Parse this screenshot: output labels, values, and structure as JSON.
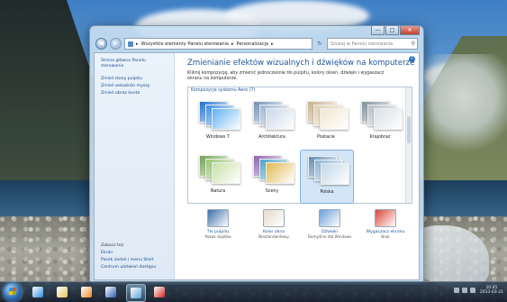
{
  "window": {
    "breadcrumb": [
      "Wszystkie elementy Panelu sterowania",
      "Personalizacja"
    ],
    "search_placeholder": "Szukaj w Panelu sterowania"
  },
  "sidebar": {
    "top_links": [
      "Strona główna Panelu sterowania",
      "Zmień ikony pulpitu",
      "Zmień wskaźniki myszy",
      "Zmień obraz konta"
    ],
    "see_also_heading": "Zobacz też",
    "bottom_links": [
      "Ekran",
      "Pasek zadań i menu Start",
      "Centrum ułatwień dostępu"
    ]
  },
  "main": {
    "title": "Zmienianie efektów wizualnych i dźwięków na komputerze",
    "subtitle": "Kliknij kompozycję, aby zmienić jednocześnie tło pulpitu, kolory okien, dźwięki i wygaszacz ekranu na komputerze.",
    "group_label": "Kompozycje systemu Aero (7)",
    "themes": [
      {
        "label": "Windows 7",
        "selected": false,
        "colors": [
          "#1e6fd0",
          "#3a8ee6",
          "#5fb1f2"
        ]
      },
      {
        "label": "Architektura",
        "selected": false,
        "colors": [
          "#6f8fb5",
          "#9bb6d3",
          "#c8d8e8"
        ]
      },
      {
        "label": "Postacie",
        "selected": false,
        "colors": [
          "#c9b28a",
          "#e0cfa9",
          "#f2e7d0"
        ]
      },
      {
        "label": "Krajobraz",
        "selected": false,
        "colors": [
          "#7f8f9a",
          "#b2bec6",
          "#d9dfe3"
        ]
      },
      {
        "label": "Natura",
        "selected": false,
        "colors": [
          "#6fa24d",
          "#98c46e",
          "#c6e1a4"
        ]
      },
      {
        "label": "Sceny",
        "selected": false,
        "colors": [
          "#8e5fb0",
          "#4aa3c8",
          "#e0b84f"
        ]
      },
      {
        "label": "Polska",
        "selected": true,
        "colors": [
          "#5c8ab5",
          "#8cb2d3",
          "#c2d7e8"
        ]
      }
    ]
  },
  "options": [
    {
      "label": "Tło pulpitu",
      "sub": "Pokaz slajdów",
      "color": "#3c6fa8"
    },
    {
      "label": "Kolor okna",
      "sub": "Niestandardowy",
      "color": "#e4dccb"
    },
    {
      "label": "Dźwięki",
      "sub": "Domyślne dla Windows",
      "color": "#6c9fd8"
    },
    {
      "label": "Wygaszacz ekranu",
      "sub": "Brak",
      "color": "#d9473a"
    }
  ],
  "taskbar": {
    "apps": [
      {
        "name": "internet-explorer-icon",
        "color": "#2e8be0",
        "active": false
      },
      {
        "name": "file-explorer-icon",
        "color": "#e8c356",
        "active": false
      },
      {
        "name": "media-player-icon",
        "color": "#f08a24",
        "active": false
      },
      {
        "name": "word-icon",
        "color": "#2b5db3",
        "active": false
      },
      {
        "name": "control-panel-icon",
        "color": "#5aa0d8",
        "active": true
      },
      {
        "name": "acrobat-icon",
        "color": "#d0261c",
        "active": false
      }
    ],
    "clock_time": "10:45",
    "clock_date": "2013-03-21"
  }
}
